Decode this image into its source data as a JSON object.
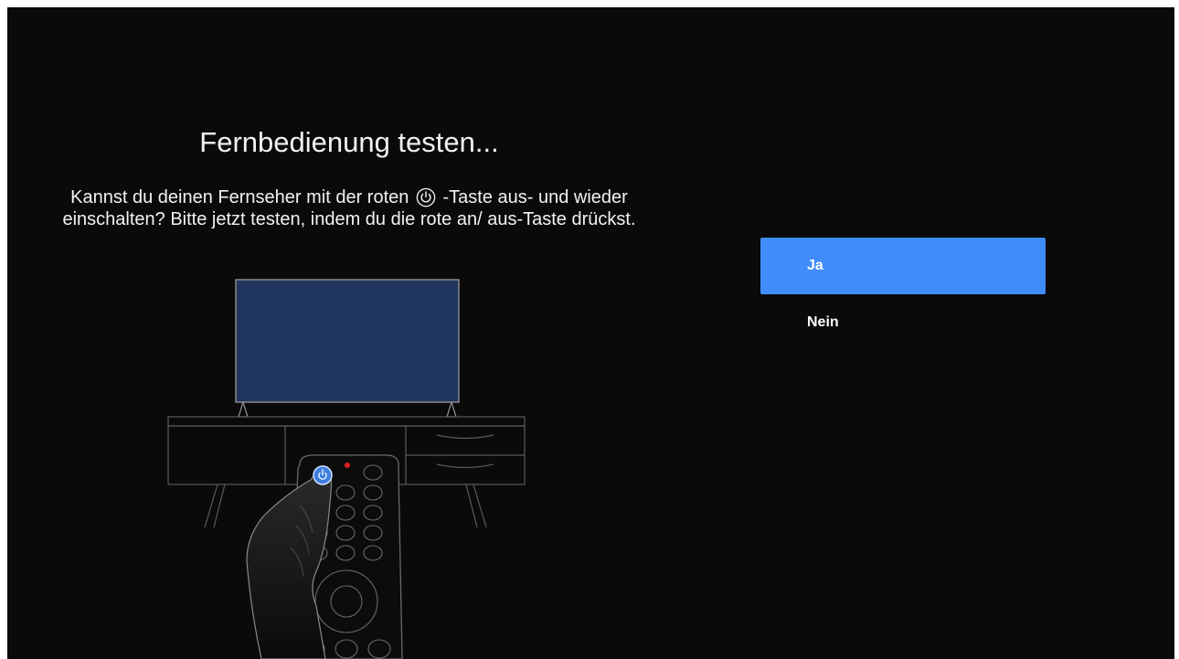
{
  "dialog": {
    "title": "Fernbedienung testen...",
    "description_part1": "Kannst du deinen Fernseher mit der roten",
    "description_part2": "-Taste aus- und wieder einschalten? Bitte jetzt testen, indem du die rote an/ aus-Taste drückst.",
    "inline_icon": "power-icon"
  },
  "options": [
    {
      "label": "Ja",
      "selected": true
    },
    {
      "label": "Nein",
      "selected": false
    }
  ],
  "colors": {
    "background": "#0a0a0a",
    "selected_option": "#3f8cfb",
    "tv_screen": "#22375f",
    "power_button": "#3f7fe0",
    "red_led": "#e02020"
  }
}
